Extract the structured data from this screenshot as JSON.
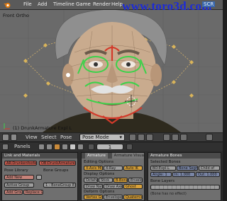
{
  "window": {
    "menus": [
      "File",
      "Add",
      "Timeline",
      "Game",
      "Render",
      "Help"
    ],
    "watermark": "www.toro3d.com",
    "screen_label": "SCR"
  },
  "viewport": {
    "view_label": "Front Ortho",
    "object_label": "(1) DrunkArmature Expl L",
    "colors": {
      "background": "#6a6a6a",
      "skin": "#c9ab8e",
      "hair": "#8a8a8a",
      "bone_green": "#3cd24a",
      "bone_red": "#d23a2a",
      "shirt": "#2e2a1e"
    }
  },
  "viewport_header": {
    "view": "View",
    "select": "Select",
    "pose": "Pose",
    "mode": "Pose Mode"
  },
  "buttons_header": {
    "panels": "Panels",
    "frame": "1"
  },
  "panels": {
    "link": {
      "title": "Link and Materials",
      "btn1": "AR:Drunkenfoofe",
      "btn2": "OB:DrunkArmature",
      "pose_library": "Pose Library",
      "bone_groups": "Bone Groups",
      "add_new": "Add New",
      "active_group": "Active Group",
      "bg_theme": "1 - BoneGroup 8",
      "add_group": "Add Group",
      "replace_group": "Replace Group"
    },
    "armature": {
      "tab1": "Armature",
      "tab2": "Armature Visualisation",
      "editing_options": "Editing Options",
      "x_axis_mirror": "X-Axis Mirror",
      "x_ray": "X-Ray",
      "auto_ik": "Auto IK",
      "display_options": "Display Options",
      "octahedron": "Octahedron",
      "stick": "Stick",
      "bbone": "B-Bone",
      "envelope": "Envelope",
      "draw_names": "Draw Names",
      "draw_axes": "Draw Axes",
      "ghost": "Ghost",
      "deform_options": "Deform Options",
      "vertex_groups": "Vertex Groups",
      "envelopes": "Envelopes",
      "quaternion": "Quaternion",
      "b_bone_rest": "B-Bone Rest",
      "rest_position": "Rest Position",
      "delay_deform": "Delay Deform"
    },
    "bones": {
      "title": "Armature Bones",
      "selected_bones": "Selected Bones",
      "bone_name": "BO:Expl.L",
      "bone_segments": "Bone Segments",
      "child_of": "Child of",
      "angle": "Angle: 1",
      "ease_in": "In: 1.000",
      "ease_out": "Out: 1.000",
      "bone_layers": "Bone Layers",
      "link_hint": "(Bone has no effect)"
    }
  }
}
